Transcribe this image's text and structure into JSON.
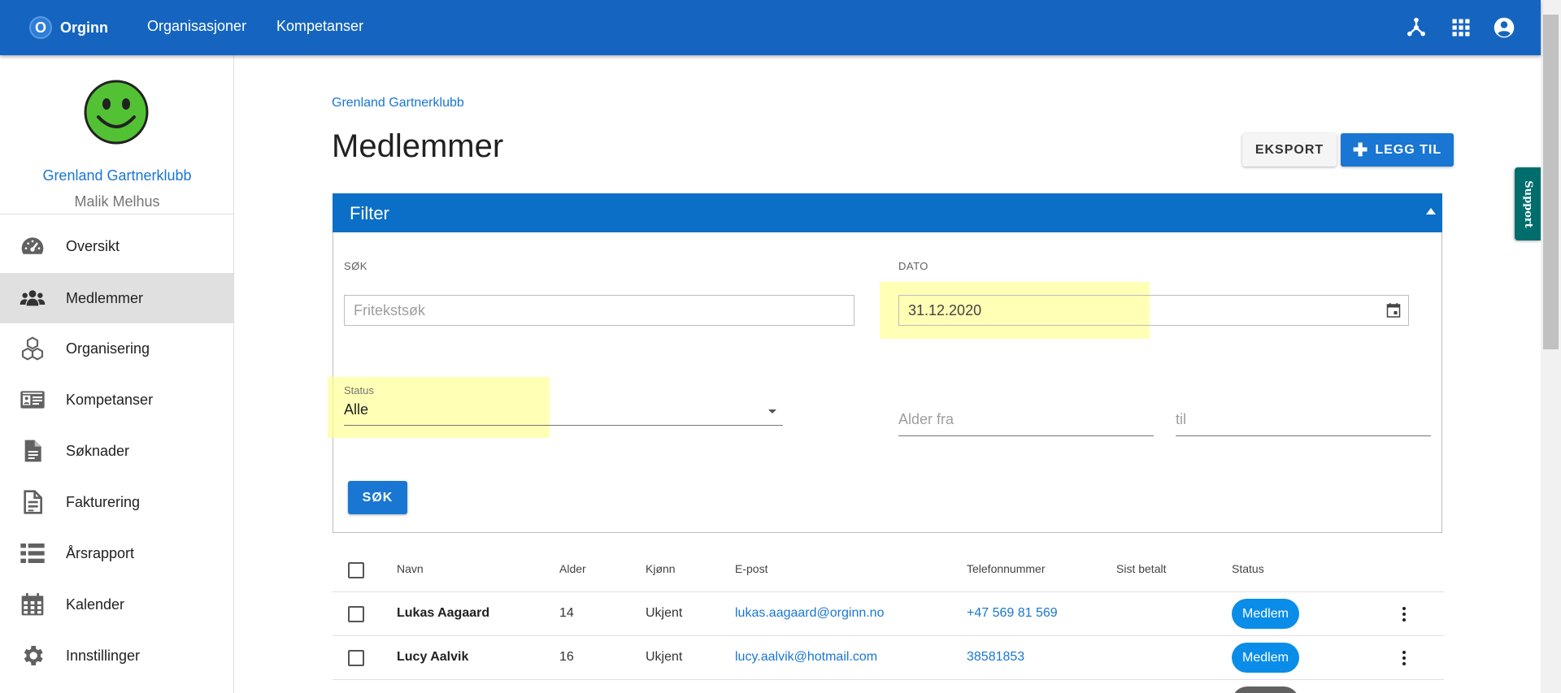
{
  "topbar": {
    "brand_letter": "O",
    "brand_name": "Orginn",
    "nav": [
      "Organisasjoner",
      "Kompetanser"
    ],
    "icons": [
      "hub-icon",
      "apps-grid-icon",
      "account-circle-icon"
    ]
  },
  "sidebar": {
    "org_name": "Grenland Gartnerklubb",
    "user_name": "Malik Melhus",
    "items": [
      {
        "label": "Oversikt",
        "icon": "dashboard-gauge-icon"
      },
      {
        "label": "Medlemmer",
        "icon": "people-icon",
        "active": true
      },
      {
        "label": "Organisering",
        "icon": "cubes-icon"
      },
      {
        "label": "Kompetanser",
        "icon": "id-card-icon"
      },
      {
        "label": "Søknader",
        "icon": "document-icon"
      },
      {
        "label": "Fakturering",
        "icon": "invoice-icon"
      },
      {
        "label": "Årsrapport",
        "icon": "list-icon"
      },
      {
        "label": "Kalender",
        "icon": "calendar-icon"
      },
      {
        "label": "Innstillinger",
        "icon": "gear-icon"
      }
    ]
  },
  "main": {
    "breadcrumb": "Grenland Gartnerklubb",
    "title": "Medlemmer",
    "export_label": "EKSPORT",
    "add_label": "LEGG TIL"
  },
  "filter": {
    "title": "Filter",
    "search_label": "SØK",
    "search_placeholder": "Fritekstsøk",
    "date_label": "DATO",
    "date_value": "31.12.2020",
    "status_label": "Status",
    "status_value": "Alle",
    "age_from_placeholder": "Alder fra",
    "age_to_placeholder": "til",
    "search_button": "SØK"
  },
  "table": {
    "headers": [
      "Navn",
      "Alder",
      "Kjønn",
      "E-post",
      "Telefonnummer",
      "Sist betalt",
      "Status"
    ],
    "rows": [
      {
        "name": "Lukas Aagaard",
        "age": "14",
        "gender": "Ukjent",
        "email": "lukas.aagaard@orginn.no",
        "phone": "+47 569 81 569",
        "last_paid": "",
        "status": "Medlem"
      },
      {
        "name": "Lucy Aalvik",
        "age": "16",
        "gender": "Ukjent",
        "email": "lucy.aalvik@hotmail.com",
        "phone": "38581853",
        "last_paid": "",
        "status": "Medlem"
      }
    ]
  },
  "support": {
    "label": "Support"
  },
  "colors": {
    "primary": "#1565c0",
    "accent": "#1976d2",
    "badge": "#0a8de8",
    "support": "#006d6d",
    "highlight": "#ffff96"
  }
}
